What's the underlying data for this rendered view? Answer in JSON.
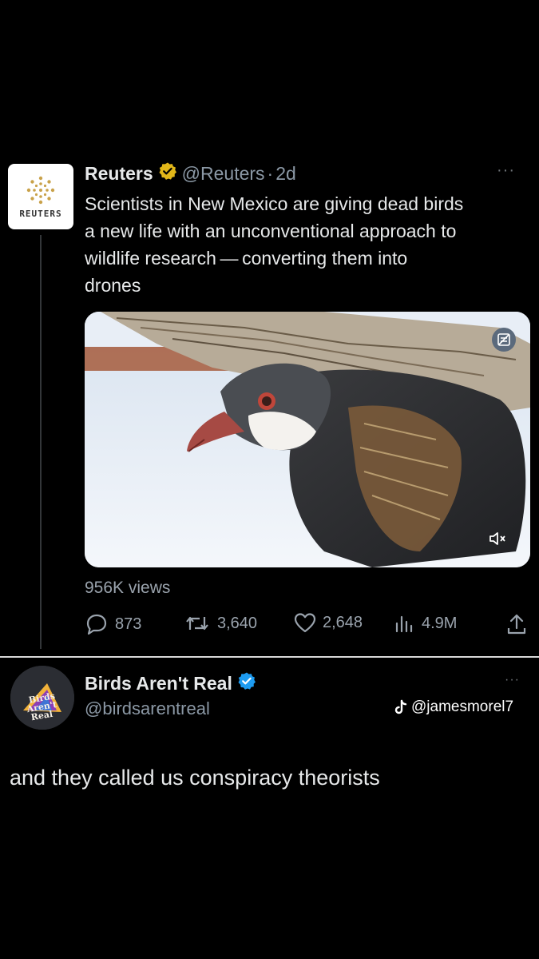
{
  "tweet": {
    "author_name": "Reuters",
    "handle": "@Reuters",
    "separator": "·",
    "time": "2d",
    "avatar_text": "REUTERS",
    "text_lines": [
      "Scientists in New Mexico are giving dead birds",
      "a new life with an unconventional approach to",
      "wildlife research — converting them into",
      "drones"
    ],
    "views_label": "956K views",
    "stats": {
      "replies": "873",
      "retweets": "3,640",
      "likes": "2,648",
      "analytics": "4.9M"
    },
    "more_label": "···"
  },
  "reply": {
    "author_name": "Birds Aren't Real",
    "handle": "@birdsarentreal",
    "avatar_text": "Birds Aren't Real",
    "text": "and they called us conspiracy theorists",
    "more_label": "···"
  },
  "watermark": {
    "text": "@jamesmorel7"
  },
  "colors": {
    "background": "#000000",
    "gold_verified": "#e2b719",
    "blue_verified": "#1d9bf0",
    "muted_text": "#8b98a5"
  },
  "icons": [
    "reuters-logo",
    "gold-verified-badge",
    "more-icon",
    "media-badge-icon",
    "mute-icon",
    "reply-icon",
    "retweet-icon",
    "like-icon",
    "analytics-icon",
    "share-icon",
    "blue-verified-badge",
    "tiktok-icon"
  ]
}
